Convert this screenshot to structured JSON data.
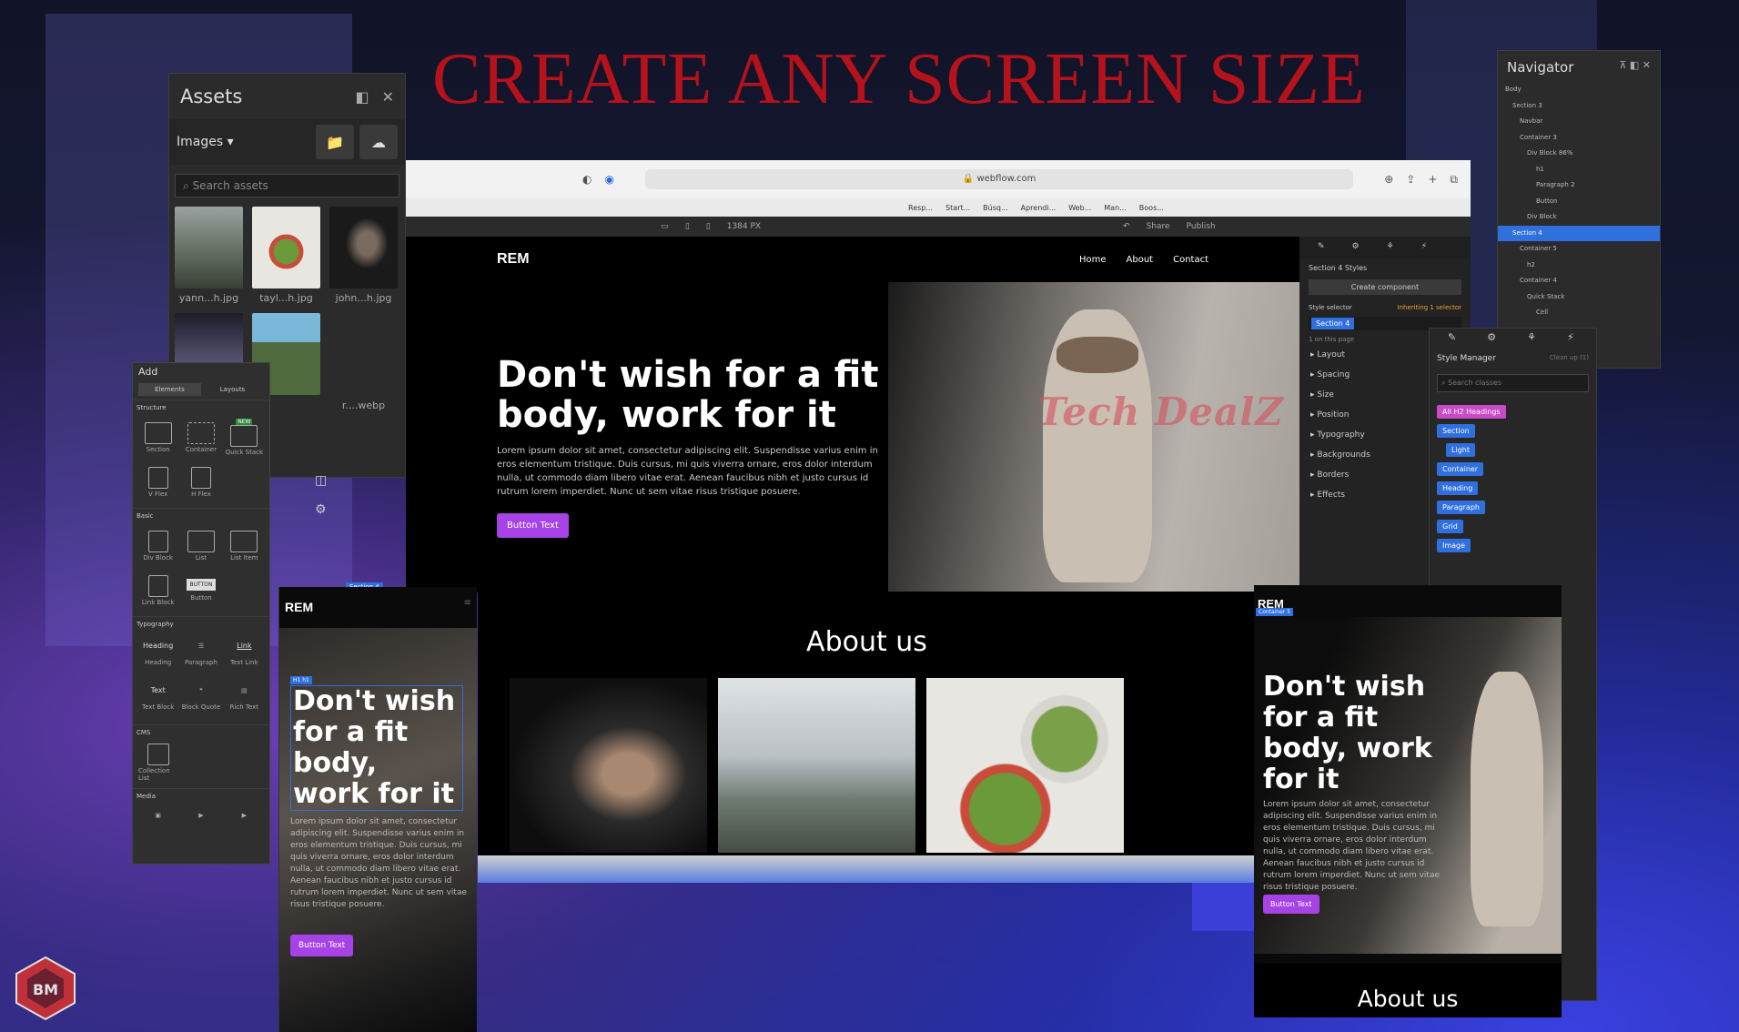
{
  "headline": "CREATE ANY SCREEN SIZE",
  "watermark": "Tech DealZ",
  "assets": {
    "title": "Assets",
    "filter": "Images",
    "search_placeholder": "Search assets",
    "files": [
      "yann...h.jpg",
      "tayl...h.jpg",
      "john...h.jpg",
      "",
      "",
      "r....webp"
    ]
  },
  "add_panel": {
    "title": "Add",
    "tabs": [
      "Elements",
      "Layouts"
    ],
    "sections": {
      "structure": "Structure",
      "basic": "Basic",
      "typography": "Typography",
      "cms": "CMS",
      "media": "Media"
    },
    "structure_items": [
      "Section",
      "Container",
      "Quick Stack",
      "V Flex",
      "H Flex"
    ],
    "basic_items": [
      "Div Block",
      "List",
      "List Item",
      "Link Block",
      "Button"
    ],
    "typography_items": [
      "Heading",
      "Paragraph",
      "Text Link",
      "Text Block",
      "Block Quote",
      "Rich Text"
    ],
    "cms_items": [
      "Collection List"
    ],
    "new_badge": "NEW",
    "button_label": "BUTTON",
    "heading_label": "Heading",
    "link_label": "Link",
    "text_label": "Text"
  },
  "browser": {
    "url": "webflow.com",
    "bookmarks": [
      "Resp...",
      "Start...",
      "Búsq...",
      "Aprendi...",
      "Web...",
      "Man...",
      "Boos..."
    ],
    "canvas_width": "1384 PX",
    "share": "Share",
    "publish": "Publish"
  },
  "site": {
    "logo": "REM",
    "nav": [
      "Home",
      "About",
      "Contact"
    ],
    "heading": "Don't wish for a fit body, work for it",
    "body": "Lorem ipsum dolor sit amet, consectetur adipiscing elit. Suspendisse varius enim in eros elementum tristique. Duis cursus, mi quis viverra ornare, eros dolor interdum nulla, ut commodo diam libero vitae erat. Aenean faucibus nibh et justo cursus id rutrum lorem imperdiet. Nunc ut sem vitae risus tristique posuere.",
    "button": "Button Text",
    "about_title": "About us"
  },
  "style_panel": {
    "selected": "Section 4 Styles",
    "create_component": "Create component",
    "selector_label": "Style selector",
    "inheriting": "Inheriting 1 selector",
    "selector_tag": "Section 4",
    "on_page": "1 on this page",
    "sections": [
      "Layout",
      "Spacing",
      "Size",
      "Position",
      "Typography",
      "Backgrounds",
      "Borders",
      "Effects"
    ]
  },
  "navigator": {
    "title": "Navigator",
    "tree": [
      "Body",
      "Section 3",
      "Navbar",
      "Container 3",
      "Div Block 86%",
      "h1",
      "Paragraph 2",
      "Button",
      "Div Block",
      "Section 4",
      "Container 5",
      "h2",
      "Container 4",
      "Quick Stack",
      "Cell"
    ]
  },
  "style_manager": {
    "title": "Style Manager",
    "clean_up": "Clean up (1)",
    "search_placeholder": "Search classes",
    "tags": [
      "All H2 Headings",
      "Section",
      "Light",
      "Container",
      "Heading",
      "Paragraph",
      "Grid",
      "Image"
    ]
  },
  "mobile_left": {
    "logo": "REM",
    "tag": "H1 h1",
    "heading": "Don't wish for a fit body, work for it",
    "body": "Lorem ipsum dolor sit amet, consectetur adipiscing elit. Suspendisse varius enim in eros elementum tristique. Duis cursus, mi quis viverra ornare, eros dolor interdum nulla, ut commodo diam libero vitae erat. Aenean faucibus nibh et justo cursus id rutrum lorem imperdiet. Nunc ut sem vitae risus tristique posuere.",
    "button": "Button Text"
  },
  "mobile_right": {
    "logo": "REM",
    "tag": "Container 5",
    "heading": "Don't wish for a fit body, work for it",
    "body": "Lorem ipsum dolor sit amet, consectetur adipiscing elit. Suspendisse varius enim in eros elementum tristique. Duis cursus, mi quis viverra ornare, eros dolor interdum nulla, ut commodo diam libero vitae erat. Aenean faucibus nibh et justo cursus id rutrum lorem imperdiet. Nunc ut sem vitae risus tristique posuere.",
    "button": "Button Text",
    "about_title": "About us"
  },
  "section_tag": "Section 4",
  "colors": {
    "headline": "#b5121b",
    "accent": "#a742e6",
    "selection": "#2f6fde"
  }
}
